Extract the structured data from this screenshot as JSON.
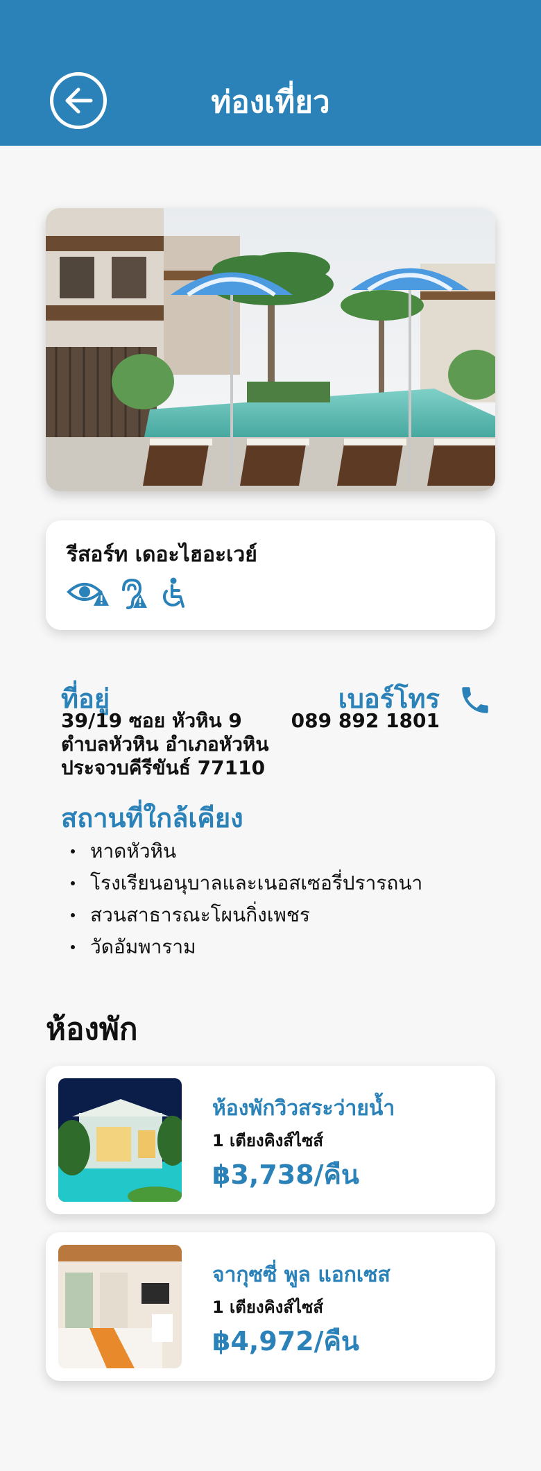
{
  "header": {
    "title": "ท่องเที่ยว",
    "back_icon": "arrow-left-circle-icon"
  },
  "resort": {
    "name": "รีสอร์ท เดอะไฮอะเวย์",
    "accessibility_icons": [
      "low-vision-warning-icon",
      "hearing-warning-icon",
      "wheelchair-icon"
    ]
  },
  "contact": {
    "address_label": "ที่อยู่",
    "address_lines": [
      "39/19 ซอย หัวหิน 9",
      "ตำบลหัวหิน อำเภอหัวหิน",
      "ประจวบคีรีขันธ์ 77110"
    ],
    "phone_label": "เบอร์โทร",
    "phone_number": "089 892 1801",
    "phone_icon": "phone-icon"
  },
  "nearby": {
    "label": "สถานที่ใกล้เคียง",
    "items": [
      "หาดหัวหิน",
      "โรงเรียนอนุบาลและเนอสเซอรี่ปรารถนา",
      "สวนสาธารณะโผนกิ่งเพชร",
      "วัดอัมพาราม"
    ]
  },
  "rooms": {
    "heading": "ห้องพัก",
    "items": [
      {
        "name": "ห้องพักวิวสระว่ายน้ำ",
        "bed": "1 เตียงคิงส์ไซส์",
        "price": "฿3,738/คืน"
      },
      {
        "name": "จากุซซี่ พูล แอกเซส",
        "bed": "1 เตียงคิงส์ไซส์",
        "price": "฿4,972/คืน"
      }
    ]
  },
  "colors": {
    "primary": "#2b82b8",
    "background": "#f7f7f7",
    "card": "#ffffff"
  }
}
